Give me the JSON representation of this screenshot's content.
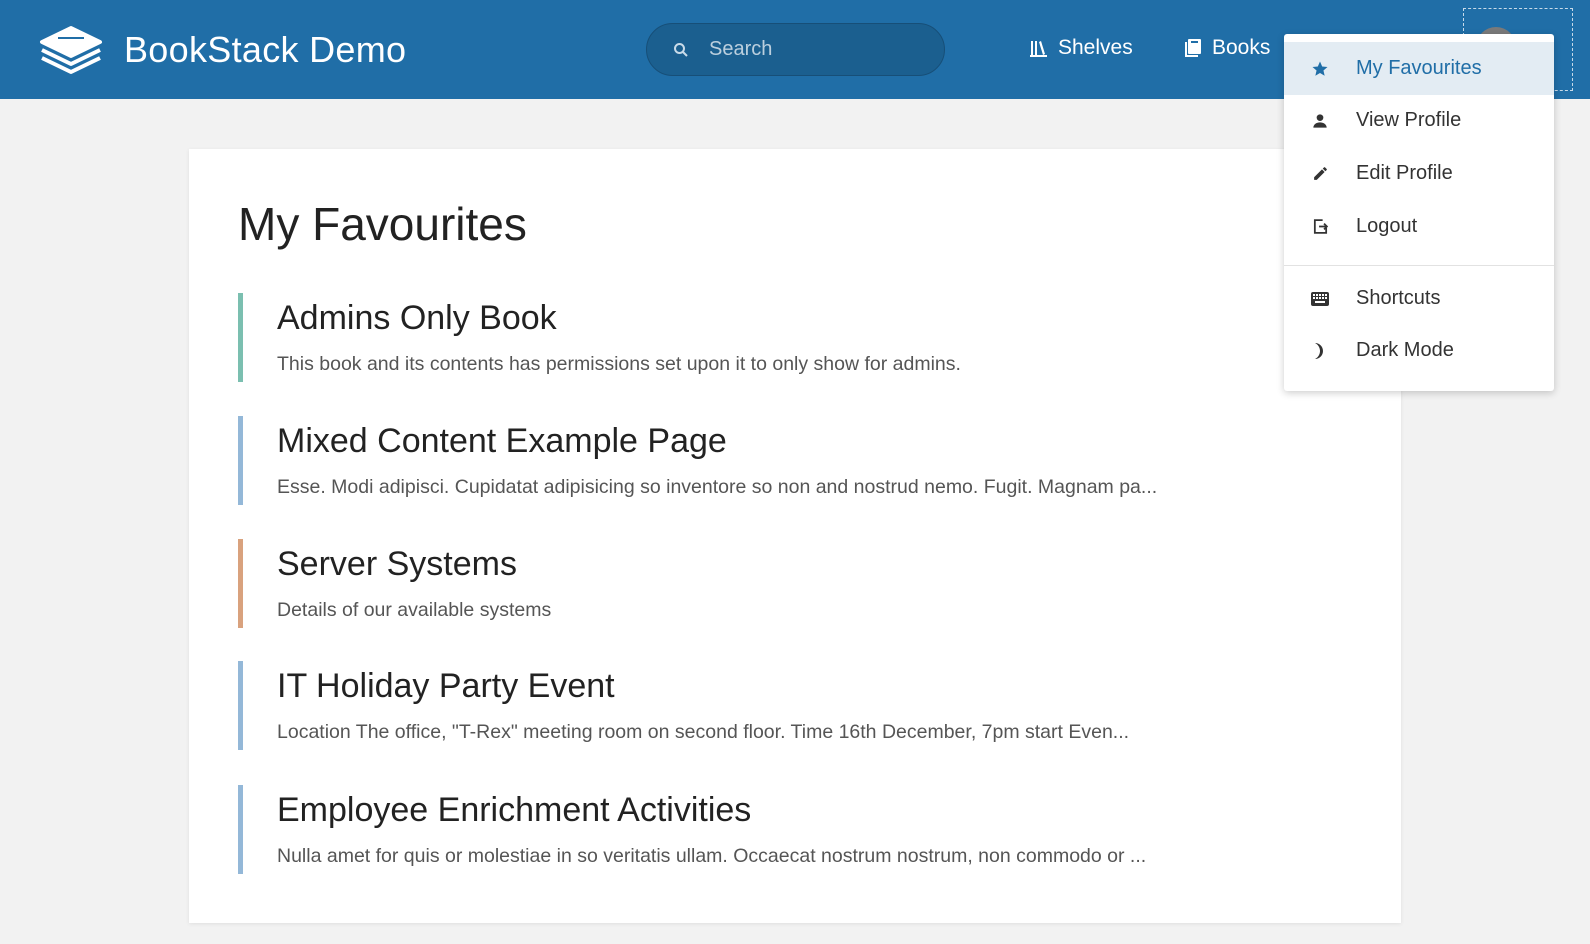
{
  "header": {
    "app_name": "BookStack Demo",
    "search_placeholder": "Search",
    "nav": [
      {
        "label": "Shelves",
        "icon": "shelves-icon"
      },
      {
        "label": "Books",
        "icon": "books-icon"
      }
    ]
  },
  "main": {
    "title": "My Favourites",
    "items": [
      {
        "title": "Admins Only Book",
        "description": "This book and its contents has permissions set upon it to only show for admins.",
        "color": "#7bbfb0"
      },
      {
        "title": "Mixed Content Example Page",
        "description": "Esse. Modi adipisci. Cupidatat adipisicing so inventore so non and nostrud nemo. Fugit. Magnam pa...",
        "color": "#94b8d8"
      },
      {
        "title": "Server Systems",
        "description": "Details of our available systems",
        "color": "#d9a27e"
      },
      {
        "title": "IT Holiday Party Event",
        "description": "Location The office, \"T-Rex\" meeting room on second floor. Time 16th December, 7pm start Even...",
        "color": "#94b8d8"
      },
      {
        "title": "Employee Enrichment Activities",
        "description": "Nulla amet for quis or molestiae in so veritatis ullam. Occaecat nostrum nostrum, non commodo or ...",
        "color": "#94b8d8"
      }
    ]
  },
  "dropdown": {
    "items": [
      {
        "label": "My Favourites",
        "icon": "star-icon",
        "active": true
      },
      {
        "label": "View Profile",
        "icon": "user-icon"
      },
      {
        "label": "Edit Profile",
        "icon": "pencil-icon"
      },
      {
        "label": "Logout",
        "icon": "logout-icon"
      },
      {
        "label": "Shortcuts",
        "icon": "keyboard-icon"
      },
      {
        "label": "Dark Mode",
        "icon": "moon-icon"
      }
    ]
  },
  "colors": {
    "header": "#206ea7",
    "accent": "#206ea7",
    "active_bg": "#e3ecf3"
  }
}
